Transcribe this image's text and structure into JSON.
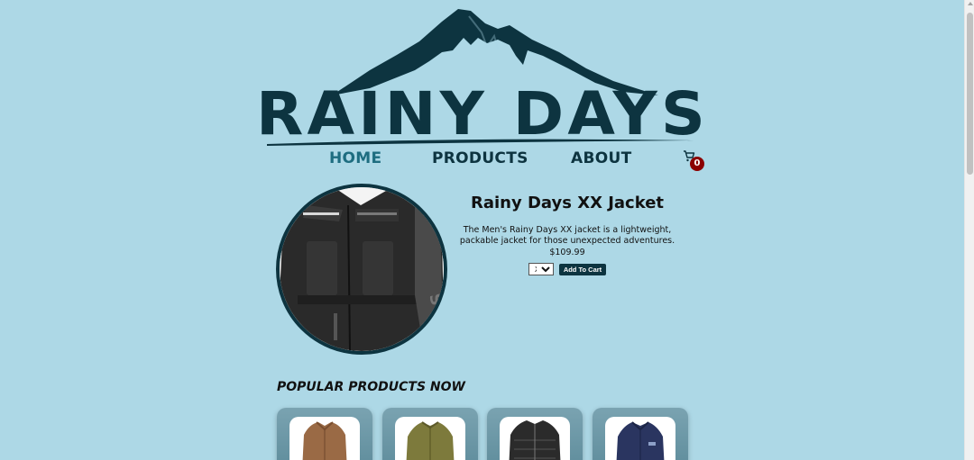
{
  "brand": {
    "logo_text": "RAINY DAYS"
  },
  "nav": {
    "items": [
      {
        "label": "HOME",
        "active": true
      },
      {
        "label": "PRODUCTS",
        "active": false
      },
      {
        "label": "ABOUT",
        "active": false
      }
    ]
  },
  "cart": {
    "count": "0",
    "icon": "cart-icon"
  },
  "product": {
    "title": "Rainy Days XX Jacket",
    "description": "The Men's Rainy Days XX jacket is a lightweight, packable jacket for those unexpected adventures.",
    "price": "$109.99",
    "size_selected": "XS",
    "add_to_cart_label": "Add To Cart"
  },
  "popular": {
    "title": "POPULAR PRODUCTS NOW",
    "items": [
      {
        "image": "brown-fleece-jacket"
      },
      {
        "image": "olive-fleece-jacket"
      },
      {
        "image": "black-quilted-jacket"
      },
      {
        "image": "navy-fleece-jacket"
      }
    ]
  },
  "colors": {
    "background": "#add8e6",
    "brand_dark": "#0d3440",
    "nav_active": "#1e6d80",
    "badge": "#8b0000"
  }
}
